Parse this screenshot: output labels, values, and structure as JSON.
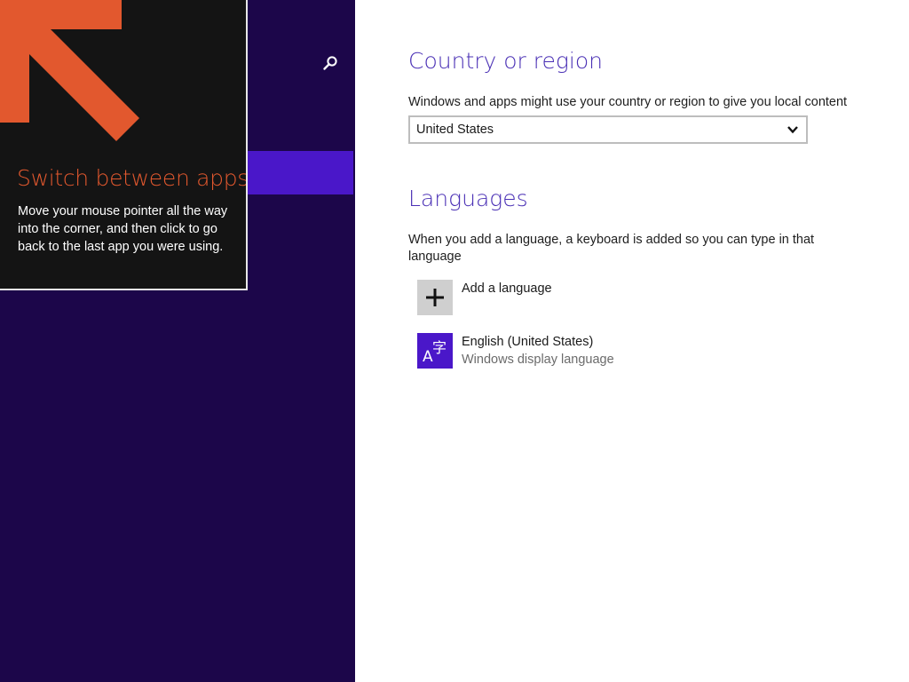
{
  "colors": {
    "nav_background": "#1c064a",
    "nav_selected": "#4a17c9",
    "tip_background": "#141414",
    "tip_accent": "#e2582e",
    "heading": "#4a30b5",
    "content_background": "#ffffff"
  },
  "nav": {
    "search_icon": "search-icon"
  },
  "tip": {
    "arrow_icon": "arrow-up-left-icon",
    "title": "Switch between apps",
    "body": "Move your mouse pointer all the way into the corner, and then click to go back to the last app you were using."
  },
  "country": {
    "heading": "Country or region",
    "description": "Windows and apps might use your country or region to give you local content",
    "selected": "United States",
    "chevron_icon": "chevron-down-icon"
  },
  "languages": {
    "heading": "Languages",
    "description": "When you add a language, a keyboard is added so you can type in that language",
    "add_label": "Add a language",
    "add_icon": "plus-icon",
    "items": [
      {
        "name": "English (United States)",
        "subtitle": "Windows display language",
        "icon": "language-icon"
      }
    ]
  }
}
